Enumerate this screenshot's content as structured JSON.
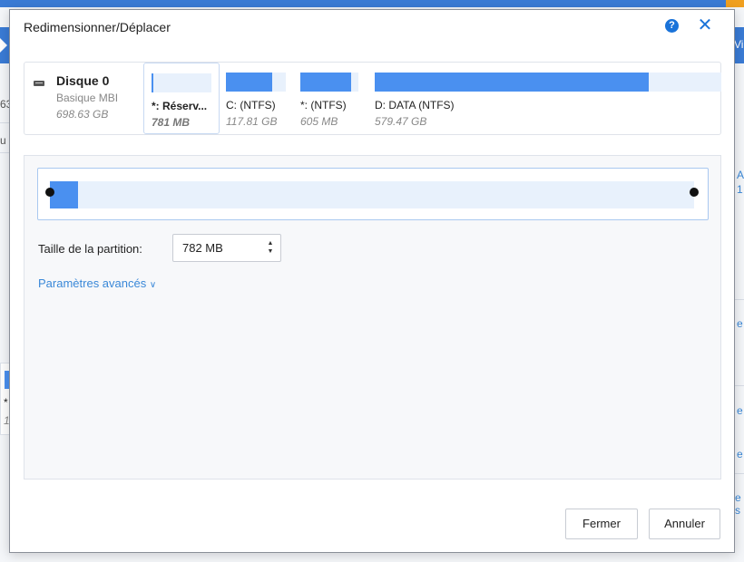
{
  "dialog": {
    "title": "Redimensionner/Déplacer",
    "help_icon": "?",
    "close_icon": "✕"
  },
  "disk": {
    "name": "Disque 0",
    "type": "Basique MBI",
    "size": "698.63 GB"
  },
  "partitions": [
    {
      "label": "*: Réserv...",
      "size": "781 MB",
      "usage_fraction": 0.03,
      "selected": true
    },
    {
      "label": "C:  (NTFS)",
      "size": "117.81 GB",
      "usage_fraction": 0.78,
      "selected": false
    },
    {
      "label": "*:  (NTFS)",
      "size": "605 MB",
      "usage_fraction": 0.88,
      "selected": false
    },
    {
      "label": "D: DATA (NTFS)",
      "size": "579.47 GB",
      "usage_fraction": 0.79,
      "selected": false
    }
  ],
  "resize": {
    "used_fraction": 0.044,
    "size_label": "Taille de la partition:",
    "size_value": "782 MB",
    "advanced_label": "Paramètres avancés"
  },
  "buttons": {
    "close_label": "Fermer",
    "cancel_label": "Annuler"
  },
  "background": {
    "fragments": [
      "63",
      "u",
      "Vi",
      "A",
      "1",
      "e",
      "e",
      "e",
      "e s",
      "*",
      "1"
    ]
  },
  "colors": {
    "accent": "#1a73d9",
    "partition_fill": "#4a90f0",
    "partition_track": "#e8f1fc",
    "link": "#3a88d8"
  }
}
